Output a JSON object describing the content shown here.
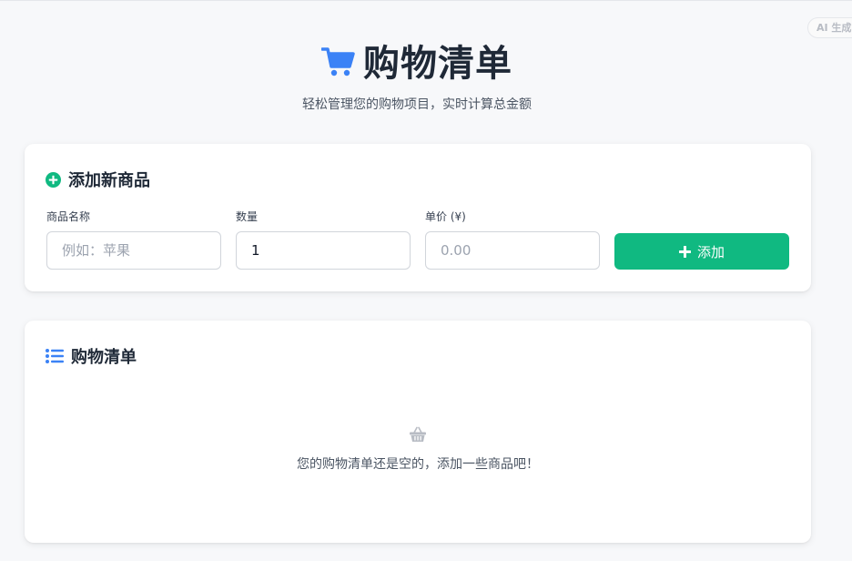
{
  "badge": {
    "text": "AI 生成"
  },
  "header": {
    "title": "购物清单",
    "subtitle": "轻松管理您的购物项目，实时计算总金额",
    "icon": "shopping-cart-icon",
    "accent_color": "#3b82f6"
  },
  "add_card": {
    "title": "添加新商品",
    "icon": "plus-circle-icon",
    "icon_color": "#10b981",
    "fields": {
      "name": {
        "label": "商品名称",
        "value": "",
        "placeholder": "例如：苹果"
      },
      "quantity": {
        "label": "数量",
        "value": "1",
        "placeholder": ""
      },
      "price": {
        "label": "单价 (¥)",
        "value": "",
        "placeholder": "0.00"
      }
    },
    "button": {
      "label": "添加",
      "icon": "plus-icon",
      "color": "#10b981"
    }
  },
  "list_card": {
    "title": "购物清单",
    "icon": "list-icon",
    "icon_color": "#3b82f6",
    "empty": {
      "icon": "basket-icon",
      "text": "您的购物清单还是空的，添加一些商品吧！"
    }
  }
}
